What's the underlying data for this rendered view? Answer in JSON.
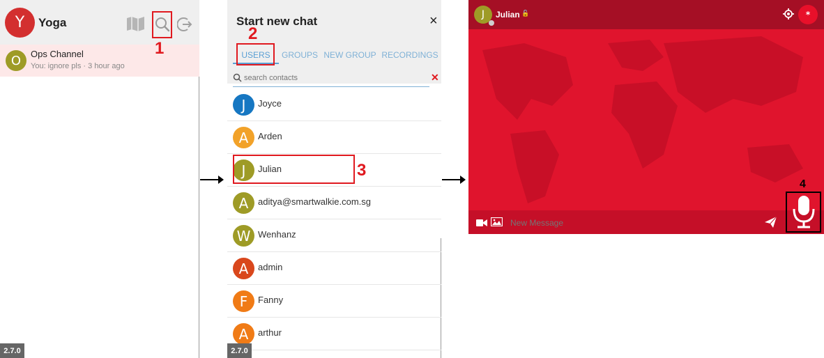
{
  "panel1": {
    "user_initial": "Y",
    "user_name": "Yoga",
    "channel": {
      "initial": "O",
      "name": "Ops Channel",
      "preview": "You: ignore pls · 3 hour ago"
    },
    "version": "2.7.0"
  },
  "panel2": {
    "title": "Start new chat",
    "close": "×",
    "tabs": [
      "USERS",
      "GROUPS",
      "NEW GROUP",
      "RECORDINGS"
    ],
    "search_placeholder": "search contacts",
    "clear": "✕",
    "contacts": [
      {
        "initial": "J",
        "name": "Joyce",
        "color": "#1677c2"
      },
      {
        "initial": "A",
        "name": "Arden",
        "color": "#f2a229"
      },
      {
        "initial": "J",
        "name": "Julian",
        "color": "#9e9b26"
      },
      {
        "initial": "A",
        "name": "aditya@smartwalkie.com.sg",
        "color": "#9e9b26"
      },
      {
        "initial": "W",
        "name": "Wenhanz",
        "color": "#9e9b26"
      },
      {
        "initial": "A",
        "name": "admin",
        "color": "#d9471c"
      },
      {
        "initial": "F",
        "name": "Fanny",
        "color": "#f07b16"
      },
      {
        "initial": "A",
        "name": "arthur",
        "color": "#f07b16"
      }
    ],
    "version": "2.7.0"
  },
  "panel3": {
    "user_initial": "J",
    "user_name": "Julian",
    "badge": "*",
    "message_placeholder": "New Message"
  },
  "annotations": {
    "step1": "1",
    "step2": "2",
    "step3": "3",
    "step4": "4"
  },
  "colors": {
    "accent_red": "#e0191f",
    "brand_red": "#e0142d",
    "tab_blue": "#7fb1d6",
    "avatar_red": "#d32f2f",
    "avatar_olive": "#9e9b26"
  }
}
